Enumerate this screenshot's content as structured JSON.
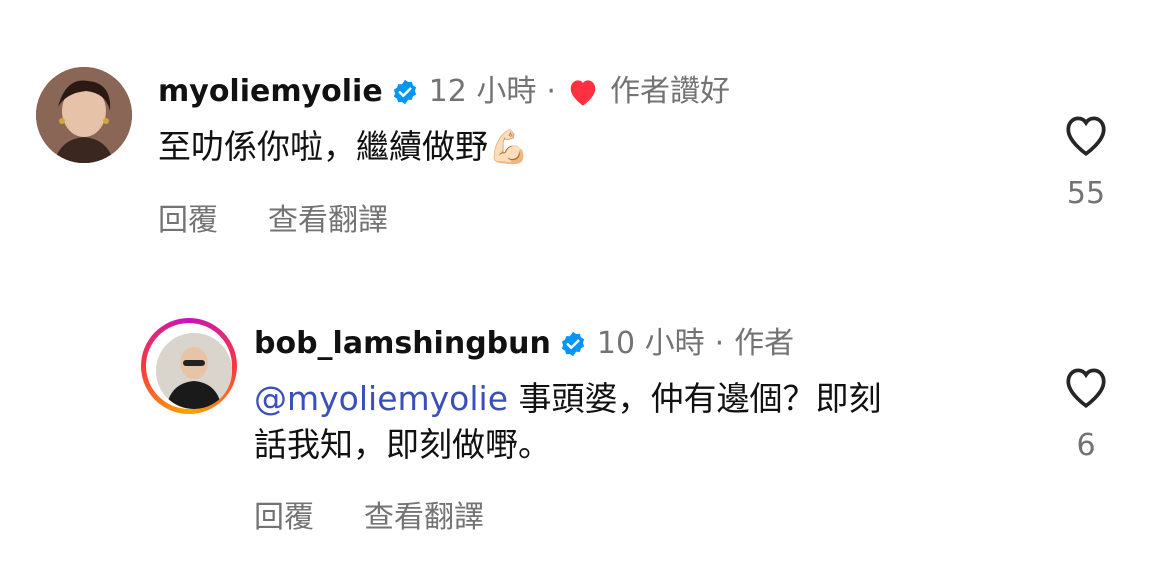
{
  "comments": [
    {
      "username": "myoliemyolie",
      "time": "12 小時",
      "separator": "·",
      "liked_label": "作者讚好",
      "text": "至叻係你啦，繼續做野",
      "emoji": "💪🏻",
      "reply_label": "回覆",
      "translate_label": "查看翻譯",
      "like_count": "55"
    },
    {
      "username": "bob_lamshingbun",
      "time": "10 小時",
      "separator": "·",
      "author_label": "作者",
      "mention": "@myoliemyolie",
      "text_line1": " 事頭婆，仲有邊個？即刻",
      "text_line2": "話我知，即刻做嘢。",
      "reply_label": "回覆",
      "translate_label": "查看翻譯",
      "like_count": "6"
    }
  ],
  "colors": {
    "verified_blue": "#0095f6",
    "heart_red": "#ff3040",
    "mention_blue": "#3b4fb8",
    "secondary_text": "#737373"
  },
  "icons": {
    "verified": "verified-badge-icon",
    "like": "heart-outline-icon",
    "author_like": "heart-filled-icon"
  }
}
